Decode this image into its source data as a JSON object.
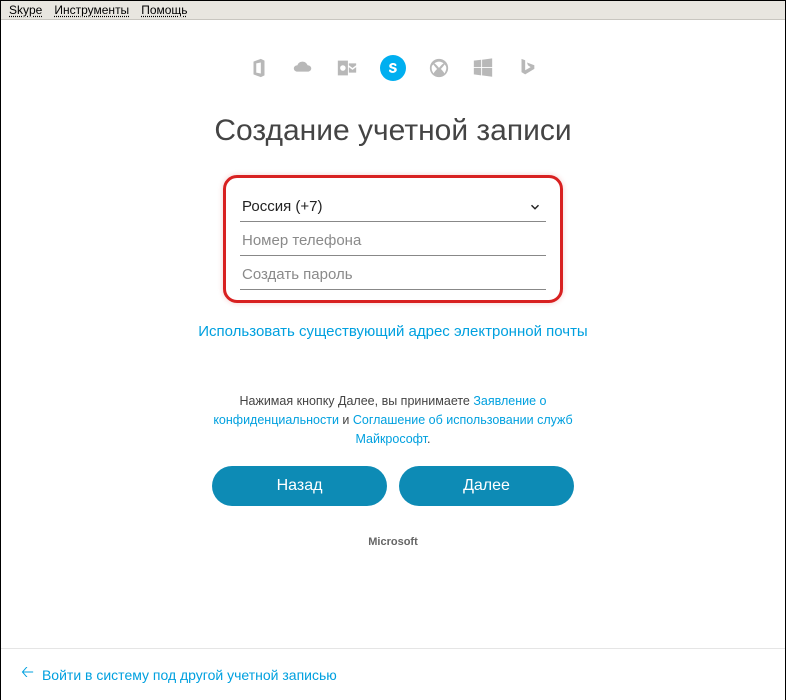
{
  "menu": {
    "skype": "Skype",
    "tools": "Инструменты",
    "help": "Помощь"
  },
  "heading": "Создание учетной записи",
  "form": {
    "country": "Россия (+7)",
    "phone_placeholder": "Номер телефона",
    "password_placeholder": "Создать пароль"
  },
  "use_email_link": "Использовать существующий адрес электронной почты",
  "terms": {
    "prefix": "Нажимая кнопку Далее, вы принимаете ",
    "privacy": "Заявление о конфиденциальности",
    "and": " и ",
    "agreement": "Соглашение об использовании служб Майкрософт",
    "suffix": "."
  },
  "buttons": {
    "back": "Назад",
    "next": "Далее"
  },
  "footer_brand": "Microsoft",
  "bottom_link": "Войти в систему под другой учетной записью"
}
